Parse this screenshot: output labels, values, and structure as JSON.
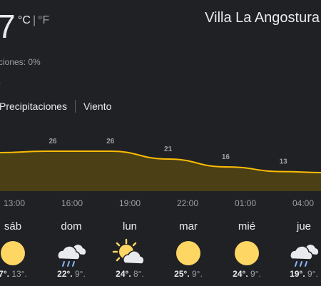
{
  "current": {
    "temperature": "7",
    "unit_c": "°C",
    "unit_sep": "|",
    "unit_f": "°F",
    "precip_text": "ciones: 0%",
    "partial_line": "."
  },
  "location": "Villa La Angostura",
  "tabs": [
    "Precipitaciones",
    "Viento"
  ],
  "chart_data": {
    "type": "area",
    "color": "#fbbc04",
    "fill": "#4a3f15",
    "x": [
      "13:00",
      "16:00",
      "19:00",
      "22:00",
      "01:00",
      "04:00"
    ],
    "labels": [
      {
        "x": "14:30",
        "value": 26
      },
      {
        "x": "17:30",
        "value": 26
      },
      {
        "x": "20:30",
        "value": 21
      },
      {
        "x": "23:30",
        "value": 16
      },
      {
        "x": "02:30",
        "value": 13
      }
    ]
  },
  "hour_labels": [
    "13:00",
    "16:00",
    "19:00",
    "22:00",
    "01:00",
    "04:00"
  ],
  "days": [
    {
      "name": "sáb",
      "icon": "sun-icon",
      "hi": "7°.",
      "lo": "13°."
    },
    {
      "name": "dom",
      "icon": "rain-cloud-icon",
      "hi": "22°.",
      "lo": "9°."
    },
    {
      "name": "lun",
      "icon": "partly-cloudy-icon",
      "hi": "24°.",
      "lo": "8°."
    },
    {
      "name": "mar",
      "icon": "sun-icon",
      "hi": "25°.",
      "lo": "9°."
    },
    {
      "name": "mié",
      "icon": "sun-icon",
      "hi": "24°.",
      "lo": "9°."
    },
    {
      "name": "jue",
      "icon": "rain-cloud-icon",
      "hi": "19°.",
      "lo": "9°."
    }
  ],
  "colors": {
    "background": "#202124",
    "sun": "#fdd663",
    "rain": "#8ab4f8",
    "cloud": "#e8eaed"
  }
}
